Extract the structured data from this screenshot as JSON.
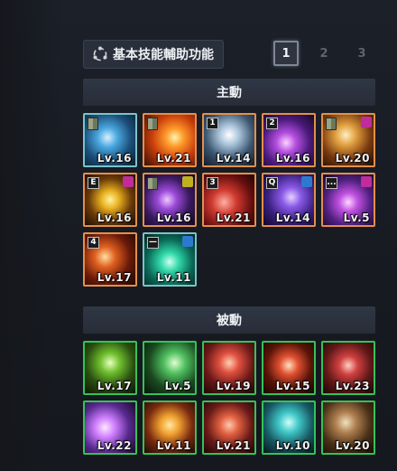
{
  "toolbar": {
    "basic_functions_label": "基本技能輔助功能"
  },
  "pagination": {
    "pages": [
      "1",
      "2",
      "3"
    ],
    "active": "1"
  },
  "sections": {
    "active_title": "主動",
    "passive_title": "被動"
  },
  "active_skills": [
    {
      "level": "Lv.16",
      "icon": "crystal-shard-icon",
      "key": "book",
      "badge": ""
    },
    {
      "level": "Lv.21",
      "icon": "fire-burst-icon",
      "key": "book",
      "badge": ""
    },
    {
      "level": "Lv.14",
      "icon": "ice-dash-icon",
      "key": "1",
      "badge": ""
    },
    {
      "level": "Lv.16",
      "icon": "violet-slash-icon",
      "key": "2",
      "badge": ""
    },
    {
      "level": "Lv.20",
      "icon": "golden-sword-icon",
      "key": "book",
      "badge": "pink"
    },
    {
      "level": "Lv.16",
      "icon": "spin-slash-icon",
      "key": "E",
      "badge": "pink"
    },
    {
      "level": "Lv.16",
      "icon": "shadow-strike-icon",
      "key": "book",
      "badge": "yellow"
    },
    {
      "level": "Lv.21",
      "icon": "crimson-vortex-icon",
      "key": "3",
      "badge": ""
    },
    {
      "level": "Lv.14",
      "icon": "arcane-bolt-icon",
      "key": "Q",
      "badge": "blue"
    },
    {
      "level": "Lv.5",
      "icon": "void-blast-icon",
      "key": "...",
      "badge": "pink"
    },
    {
      "level": "Lv.17",
      "icon": "flame-warrior-icon",
      "key": "4",
      "badge": ""
    },
    {
      "level": "Lv.11",
      "icon": "emerald-swirl-icon",
      "key": "—",
      "badge": "blue"
    }
  ],
  "passive_skills": [
    {
      "level": "Lv.17",
      "icon": "green-titan-icon"
    },
    {
      "level": "Lv.5",
      "icon": "green-blade-icon"
    },
    {
      "level": "Lv.19",
      "icon": "red-fury-icon"
    },
    {
      "level": "Lv.15",
      "icon": "war-cry-icon"
    },
    {
      "level": "Lv.23",
      "icon": "flex-strength-icon"
    },
    {
      "level": "Lv.22",
      "icon": "violet-shield-icon"
    },
    {
      "level": "Lv.11",
      "icon": "fire-aura-icon"
    },
    {
      "level": "Lv.21",
      "icon": "rage-roar-icon"
    },
    {
      "level": "Lv.10",
      "icon": "cyan-mech-icon"
    },
    {
      "level": "Lv.20",
      "icon": "rugged-hero-icon"
    }
  ],
  "colors": {
    "active_border": "#e3904c",
    "passive_border": "#35c25a"
  }
}
